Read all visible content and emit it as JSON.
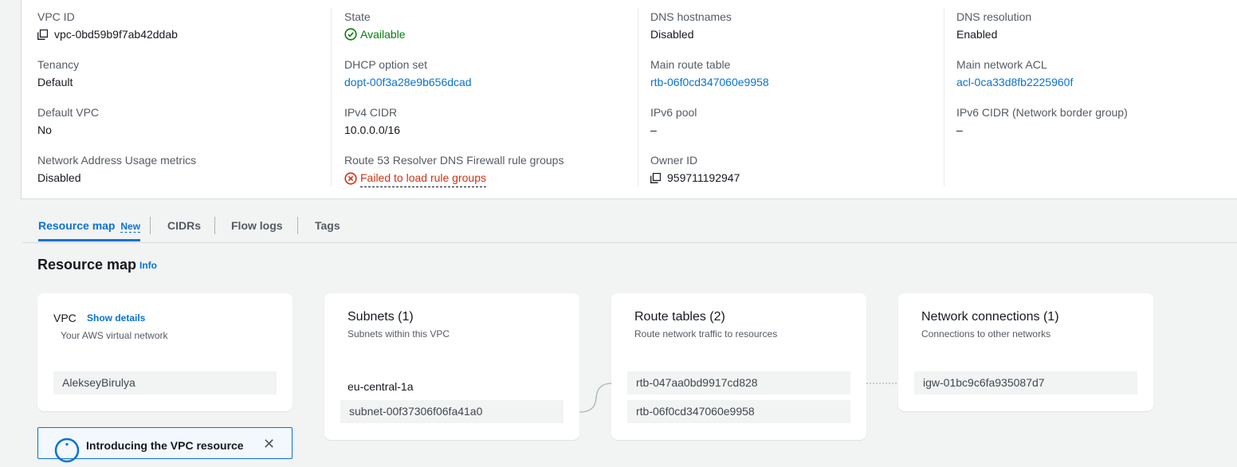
{
  "details": {
    "vpc_id": {
      "label": "VPC ID",
      "value": "vpc-0bd59b9f7ab42ddab"
    },
    "state": {
      "label": "State",
      "value": "Available"
    },
    "dns_hostnames": {
      "label": "DNS hostnames",
      "value": "Disabled"
    },
    "dns_resolution": {
      "label": "DNS resolution",
      "value": "Enabled"
    },
    "tenancy": {
      "label": "Tenancy",
      "value": "Default"
    },
    "dhcp": {
      "label": "DHCP option set",
      "value": "dopt-00f3a28e9b656dcad"
    },
    "main_route_table": {
      "label": "Main route table",
      "value": "rtb-06f0cd347060e9958"
    },
    "main_acl": {
      "label": "Main network ACL",
      "value": "acl-0ca33d8fb2225960f"
    },
    "default_vpc": {
      "label": "Default VPC",
      "value": "No"
    },
    "ipv4_cidr": {
      "label": "IPv4 CIDR",
      "value": "10.0.0.0/16"
    },
    "ipv6_pool": {
      "label": "IPv6 pool",
      "value": "–"
    },
    "ipv6_cidr": {
      "label": "IPv6 CIDR (Network border group)",
      "value": "–"
    },
    "nau_metrics": {
      "label": "Network Address Usage metrics",
      "value": "Disabled"
    },
    "route53": {
      "label": "Route 53 Resolver DNS Firewall rule groups",
      "value": "Failed to load rule groups"
    },
    "owner": {
      "label": "Owner ID",
      "value": "959711192947"
    }
  },
  "tabs": [
    {
      "label": "Resource map",
      "badge": "New"
    },
    {
      "label": "CIDRs"
    },
    {
      "label": "Flow logs"
    },
    {
      "label": "Tags"
    }
  ],
  "resource_map": {
    "title": "Resource map",
    "info": "Info",
    "vpc": {
      "title": "VPC",
      "show_details": "Show details",
      "subtitle": "Your AWS virtual network",
      "name": "AlekseyBirulya"
    },
    "subnets": {
      "title": "Subnets (1)",
      "subtitle": "Subnets within this VPC",
      "az": "eu-central-1a",
      "items": [
        "subnet-00f37306f06fa41a0"
      ]
    },
    "route_tables": {
      "title": "Route tables (2)",
      "subtitle": "Route network traffic to resources",
      "items": [
        "rtb-047aa0bd9917cd828",
        "rtb-06f0cd347060e9958"
      ]
    },
    "network_connections": {
      "title": "Network connections (1)",
      "subtitle": "Connections to other networks",
      "items": [
        "igw-01bc9c6fa935087d7"
      ]
    }
  },
  "banner": {
    "text": "Introducing the VPC resource"
  },
  "colors": {
    "link": "#0972d3",
    "success": "#037f0c",
    "error": "#d13212"
  }
}
